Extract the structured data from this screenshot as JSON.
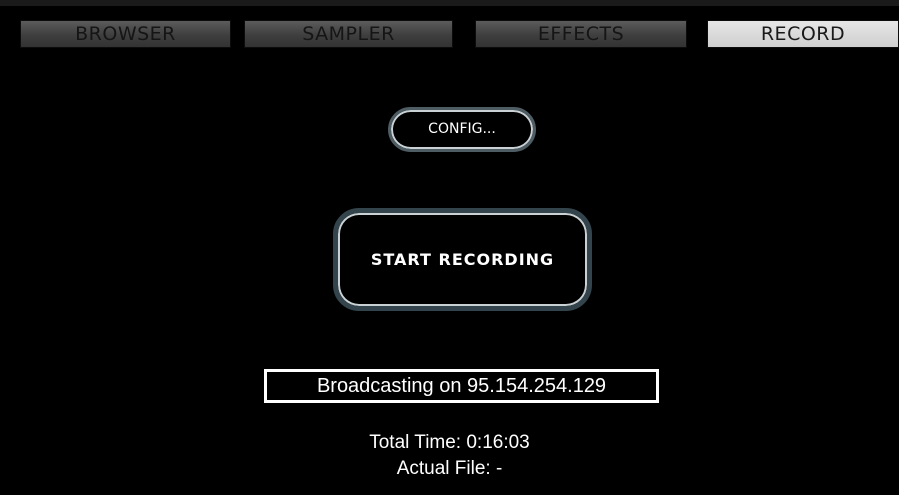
{
  "tabs": [
    {
      "label": "BROWSER",
      "active": false
    },
    {
      "label": "SAMPLER",
      "active": false
    },
    {
      "label": "EFFECTS",
      "active": false
    },
    {
      "label": "RECORD",
      "active": true
    }
  ],
  "record": {
    "config_label": "CONFIG...",
    "start_label": "START RECORDING",
    "broadcast_text": "Broadcasting on 95.154.254.129",
    "total_time_text": "Total Time: 0:16:03",
    "actual_file_text": "Actual File:  -"
  },
  "colors": {
    "background": "#000000",
    "tab_inactive": "#3e3e3e",
    "tab_active": "#d9d9d9",
    "button_border": "#34444c"
  }
}
